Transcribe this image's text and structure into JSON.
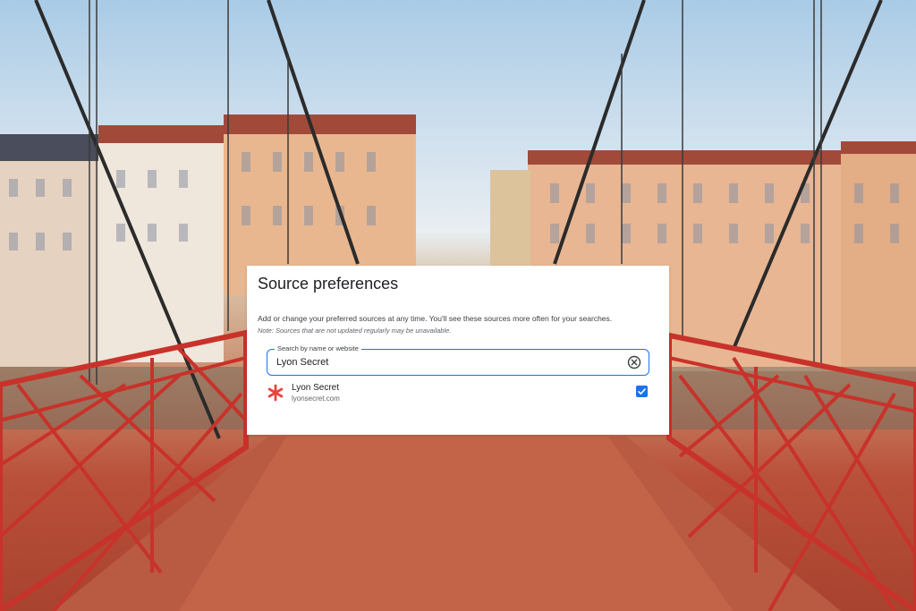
{
  "dialog": {
    "title": "Source preferences",
    "description": "Add or change your preferred sources at any time. You'll see these sources more often for your searches.",
    "note": "Note: Sources that are not updated regularly may be unavailable."
  },
  "search": {
    "label": "Search by name or website",
    "value": "Lyon Secret",
    "clear_icon": "clear-circle-icon"
  },
  "results": [
    {
      "name": "Lyon Secret",
      "url": "lyonsecret.com",
      "logo_icon": "asterisk-logo-icon",
      "logo_color": "#e8453c",
      "checked": true
    }
  ],
  "colors": {
    "accent": "#1a73e8",
    "railing": "#c8322a"
  }
}
